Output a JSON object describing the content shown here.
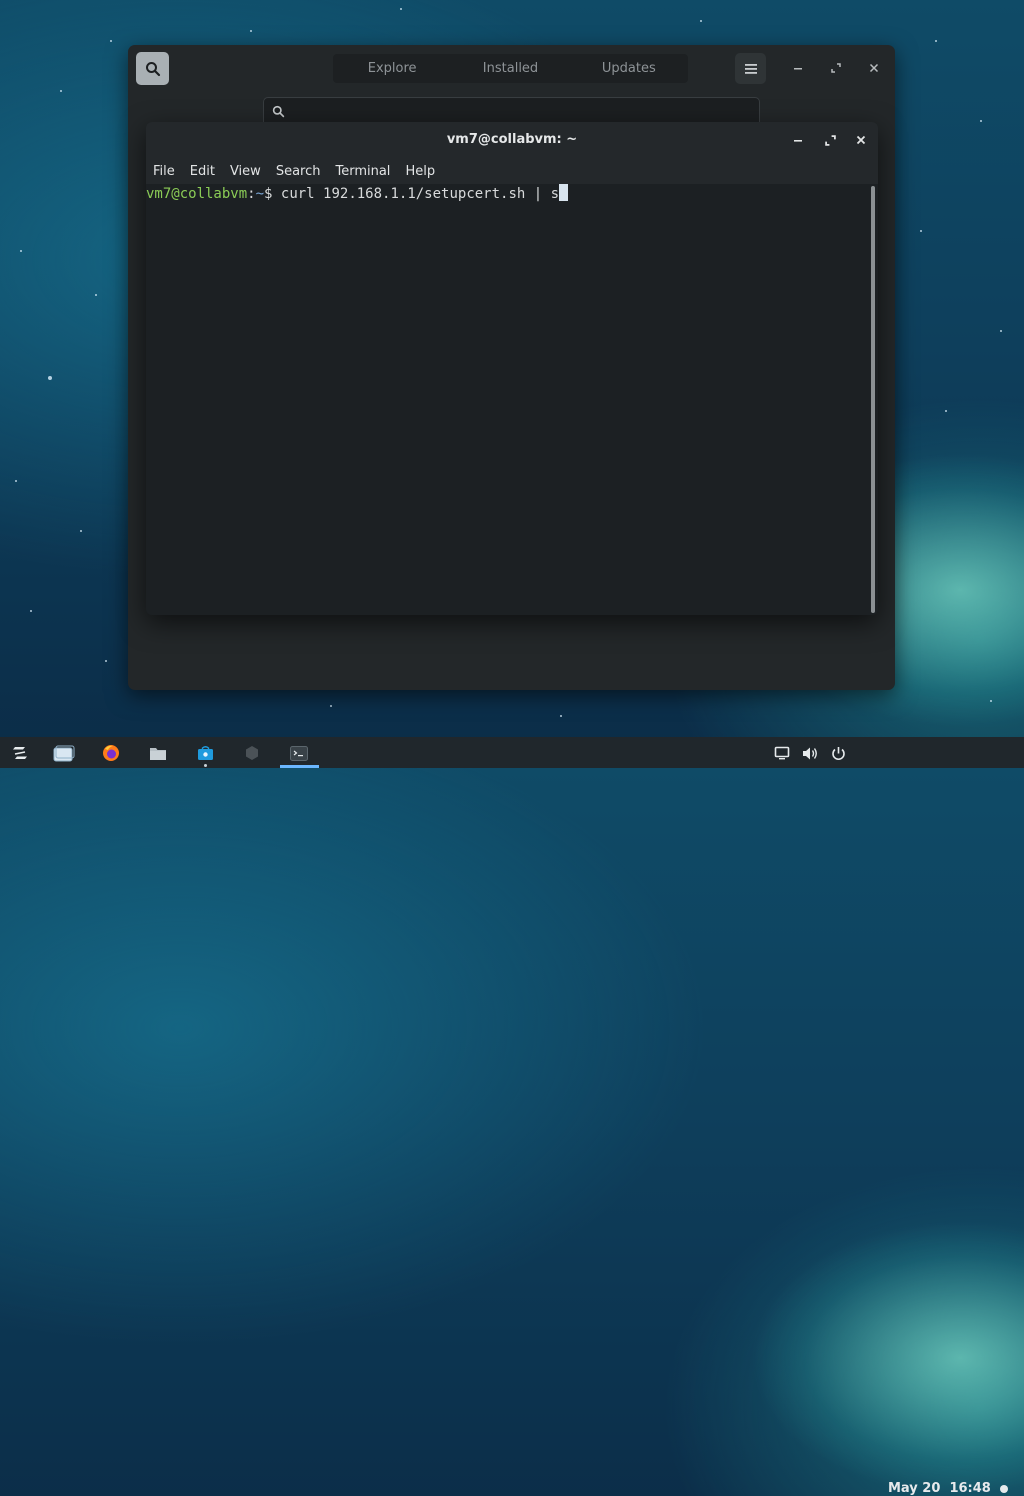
{
  "software": {
    "tabs": [
      "Explore",
      "Installed",
      "Updates"
    ],
    "search_placeholder": ""
  },
  "terminal": {
    "title": "vm7@collabvm: ~",
    "menu": [
      "File",
      "Edit",
      "View",
      "Search",
      "Terminal",
      "Help"
    ],
    "prompt_user": "vm7@collabvm",
    "prompt_sep": ":",
    "prompt_cwd": "~",
    "prompt_symbol": "$ ",
    "command": "curl 192.168.1.1/setupcert.sh | s"
  },
  "taskbar": {
    "apps": [
      "zorin-menu-icon",
      "workspaces-icon",
      "firefox-icon",
      "files-icon",
      "software-store-icon",
      "settings-icon",
      "terminal-icon"
    ],
    "clock_date": "May 20",
    "clock_time": "16:48"
  },
  "colors": {
    "prompt_user": "#8bcc56",
    "prompt_cwd": "#7aa6d6",
    "accent": "#6bb7ff"
  }
}
